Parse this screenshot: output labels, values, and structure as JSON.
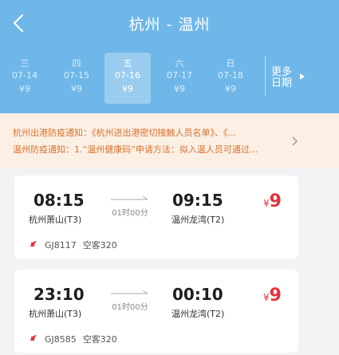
{
  "header": {
    "title": "杭州 - 温州"
  },
  "days": [
    {
      "weekday": "三",
      "date": "07-14",
      "price": "¥9",
      "selected": false
    },
    {
      "weekday": "四",
      "date": "07-15",
      "price": "¥9",
      "selected": false
    },
    {
      "weekday": "五",
      "date": "07-16",
      "price": "¥9",
      "selected": true
    },
    {
      "weekday": "六",
      "date": "07-17",
      "price": "¥9",
      "selected": false
    },
    {
      "weekday": "日",
      "date": "07-18",
      "price": "¥9",
      "selected": false
    }
  ],
  "more_dates": {
    "line1": "更多",
    "line2": "日期"
  },
  "notices": [
    "杭州出港防疫通知：《杭州进出港密切接触人员名单》、《...",
    "温州防疫通知：1.“温州健康码”申请方法：拟入温人员可通过..."
  ],
  "flights": [
    {
      "dep_time": "08:15",
      "dep_airport": "杭州萧山(T3)",
      "duration": "01时00分",
      "arr_time": "09:15",
      "arr_airport": "温州龙湾(T2)",
      "currency": "¥",
      "price": "9",
      "flight_no": "GJ8117",
      "aircraft": "空客320"
    },
    {
      "dep_time": "23:10",
      "dep_airport": "杭州萧山(T3)",
      "duration": "01时00分",
      "arr_time": "00:10",
      "arr_airport": "温州龙湾(T2)",
      "currency": "¥",
      "price": "9",
      "flight_no": "GJ8585",
      "aircraft": "空客320"
    }
  ],
  "colors": {
    "header": "#6fb7e8",
    "notice_bg": "#fcefe4",
    "notice_text": "#d9722e",
    "price": "#e4343c"
  },
  "icons": {
    "back": "chevron-left-icon",
    "more": "chevron-right-icon",
    "notice": "chevron-right-icon",
    "airline": "airline-logo-icon"
  }
}
